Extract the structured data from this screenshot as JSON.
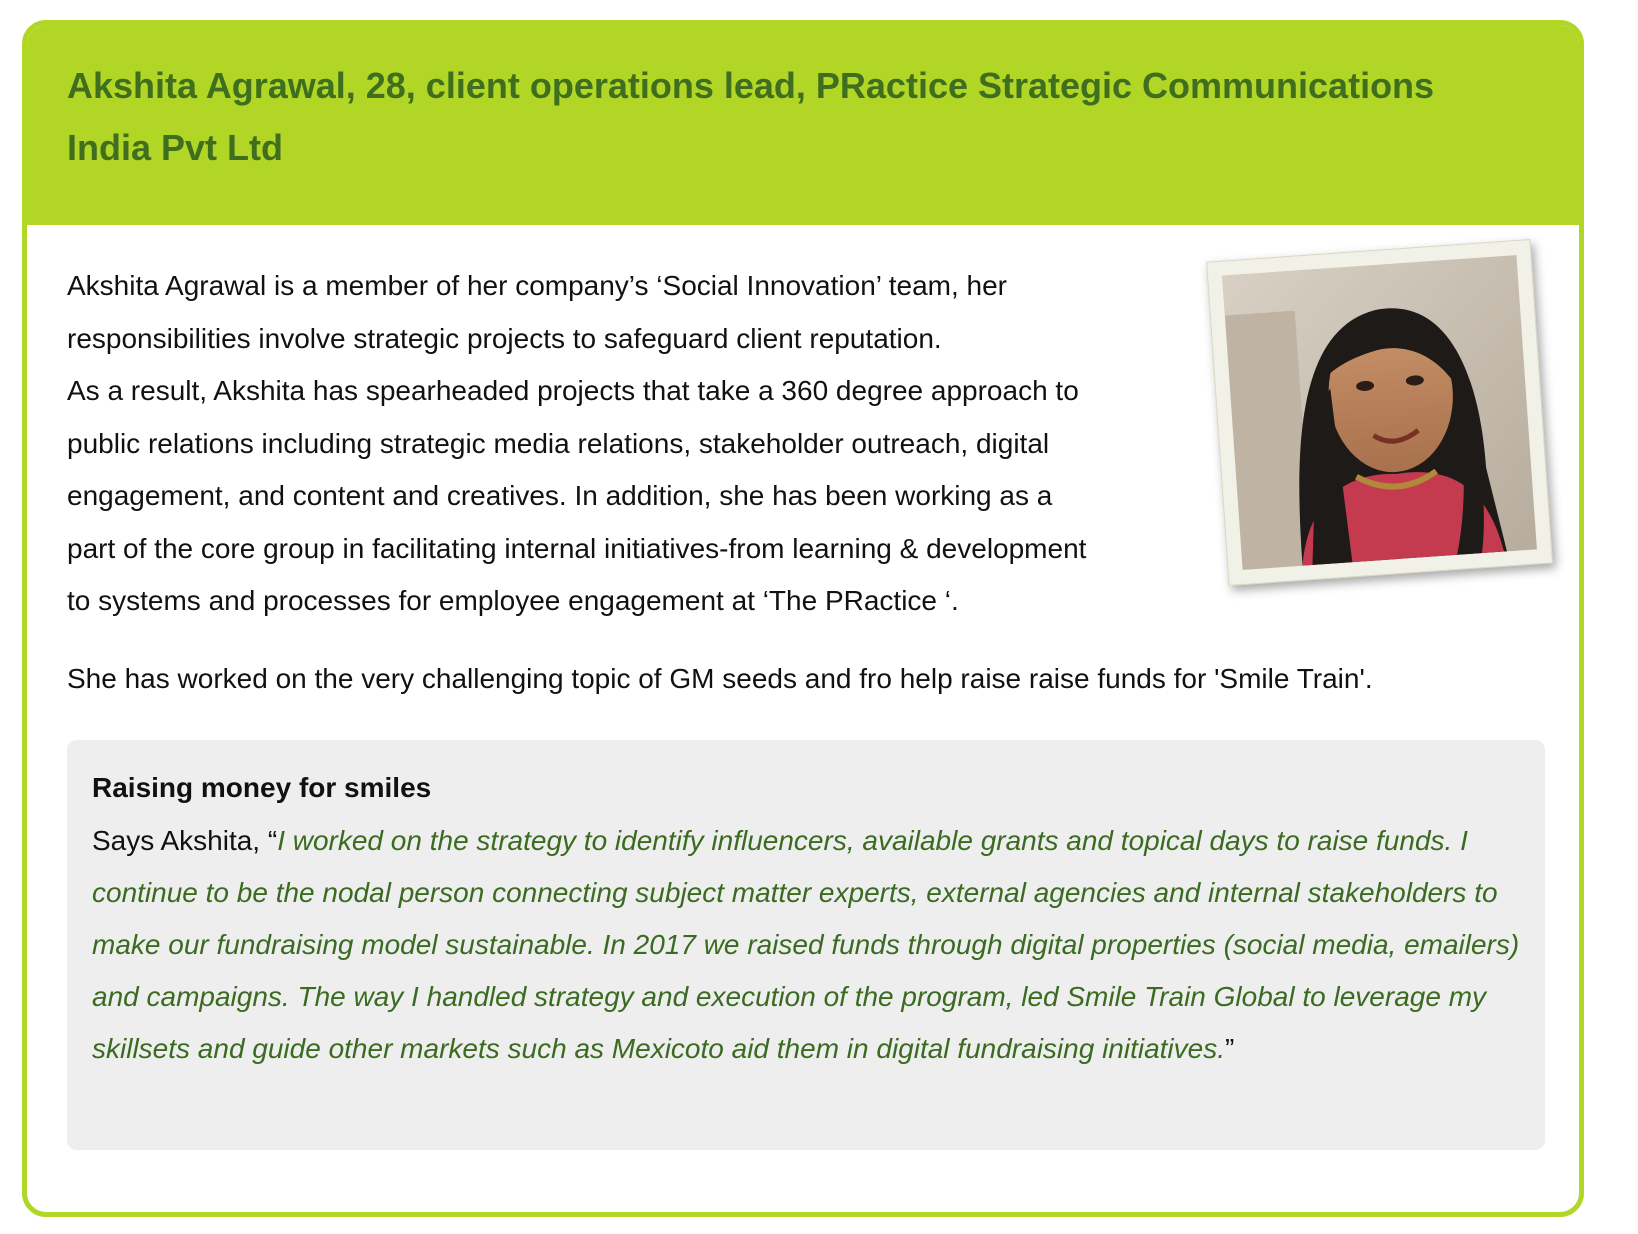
{
  "card": {
    "title": "Akshita Agrawal,  28, client operations lead, PRactice Strategic Communications India Pvt Ltd",
    "accent_color": "#b2d625",
    "title_color": "#3e6e1e"
  },
  "bio": {
    "lines": [
      "Akshita Agrawal is a member of her company’s ‘Social Innovation’ team, her",
      "responsibilities involve strategic projects to safeguard client reputation.",
      "As a result, Akshita has spearheaded projects that take a 360 degree approach to",
      "public relations including strategic media relations, stakeholder outreach, digital",
      "engagement, and content and creatives. In addition, she has been working as a",
      "part of the core group in facilitating internal initiatives-from learning & development",
      "to systems and processes for employee engagement at ‘The PRactice ‘."
    ],
    "note": "She has worked on the very challenging topic of GM seeds and fro help raise raise funds for 'Smile Train'."
  },
  "photo": {
    "subject": "portrait-photo"
  },
  "quote": {
    "heading": "Raising money for smiles",
    "intro": "Says Akshita, “",
    "body": "I worked on the strategy to identify influencers, available grants and topical days to raise funds. I continue to be the nodal person connecting subject matter experts, external agencies and internal stakeholders to make our fundraising model sustainable. In 2017  we raised funds through digital properties (social media, emailers) and campaigns. The way I handled strategy and execution of the program, led Smile Train Global to leverage my skillsets and guide other markets such as Mexicoto aid them in digital fundraising initiatives.",
    "outro": "”",
    "quote_color": "#3a6b21"
  }
}
